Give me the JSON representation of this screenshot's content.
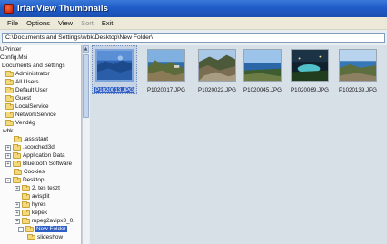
{
  "window": {
    "title": "IrfanView Thumbnails"
  },
  "menu": [
    {
      "label": "File",
      "enabled": true
    },
    {
      "label": "Options",
      "enabled": true
    },
    {
      "label": "View",
      "enabled": true
    },
    {
      "label": "Sort",
      "enabled": false
    },
    {
      "label": "Exit",
      "enabled": true
    }
  ],
  "path": "C:\\Documents and Settings\\wbk\\Desktop\\New Folder\\",
  "tree": {
    "items": [
      {
        "label": "UPrinter",
        "expander": "",
        "folder": false
      },
      {
        "label": "Config.Msi",
        "expander": "",
        "folder": false
      },
      {
        "label": "Documents and Settings",
        "expander": "",
        "folder": false
      },
      {
        "label": "Administrator",
        "expander": "",
        "folder": true
      },
      {
        "label": "All Users",
        "expander": "",
        "folder": true
      },
      {
        "label": "Default User",
        "expander": "",
        "folder": true
      },
      {
        "label": "Guest",
        "expander": "",
        "folder": true
      },
      {
        "label": "LocalService",
        "expander": "",
        "folder": true
      },
      {
        "label": "NetworkService",
        "expander": "",
        "folder": true
      },
      {
        "label": "Vendég",
        "expander": "",
        "folder": true
      },
      {
        "label": "wbk",
        "expander": "",
        "folder": false
      },
      {
        "label": ".assistant",
        "expander": "",
        "folder": true
      },
      {
        "label": ".scorched3d",
        "expander": "+",
        "folder": true
      },
      {
        "label": "Application Data",
        "expander": "+",
        "folder": true
      },
      {
        "label": "Bluetooth Software",
        "expander": "+",
        "folder": true
      },
      {
        "label": "Cookies",
        "expander": "",
        "folder": true
      },
      {
        "label": "Desktop",
        "expander": "-",
        "folder": true
      },
      {
        "label": "2. tes teszt",
        "expander": "+",
        "folder": true
      },
      {
        "label": "avisplit",
        "expander": "",
        "folder": true
      },
      {
        "label": "hyres",
        "expander": "+",
        "folder": true
      },
      {
        "label": "képek",
        "expander": "+",
        "folder": true
      },
      {
        "label": "mpeg2avipx3_0.",
        "expander": "+",
        "folder": true
      },
      {
        "label": "New Folder",
        "expander": "-",
        "folder": true,
        "selected": true
      },
      {
        "label": "slideshow",
        "expander": "",
        "folder": true
      }
    ]
  },
  "thumbnails": [
    {
      "caption": "P1020013.JPG",
      "selected": true,
      "scene": "blue-harbor"
    },
    {
      "caption": "P1020017.JPG",
      "selected": false,
      "scene": "coast-cliffs"
    },
    {
      "caption": "P1020022.JPG",
      "selected": false,
      "scene": "rocky-hill"
    },
    {
      "caption": "P1020045.JPG",
      "selected": false,
      "scene": "sea-horizon"
    },
    {
      "caption": "P1020069.JPG",
      "selected": false,
      "scene": "night-pool"
    },
    {
      "caption": "P1020139.JPG",
      "selected": false,
      "scene": "bay-view"
    }
  ]
}
